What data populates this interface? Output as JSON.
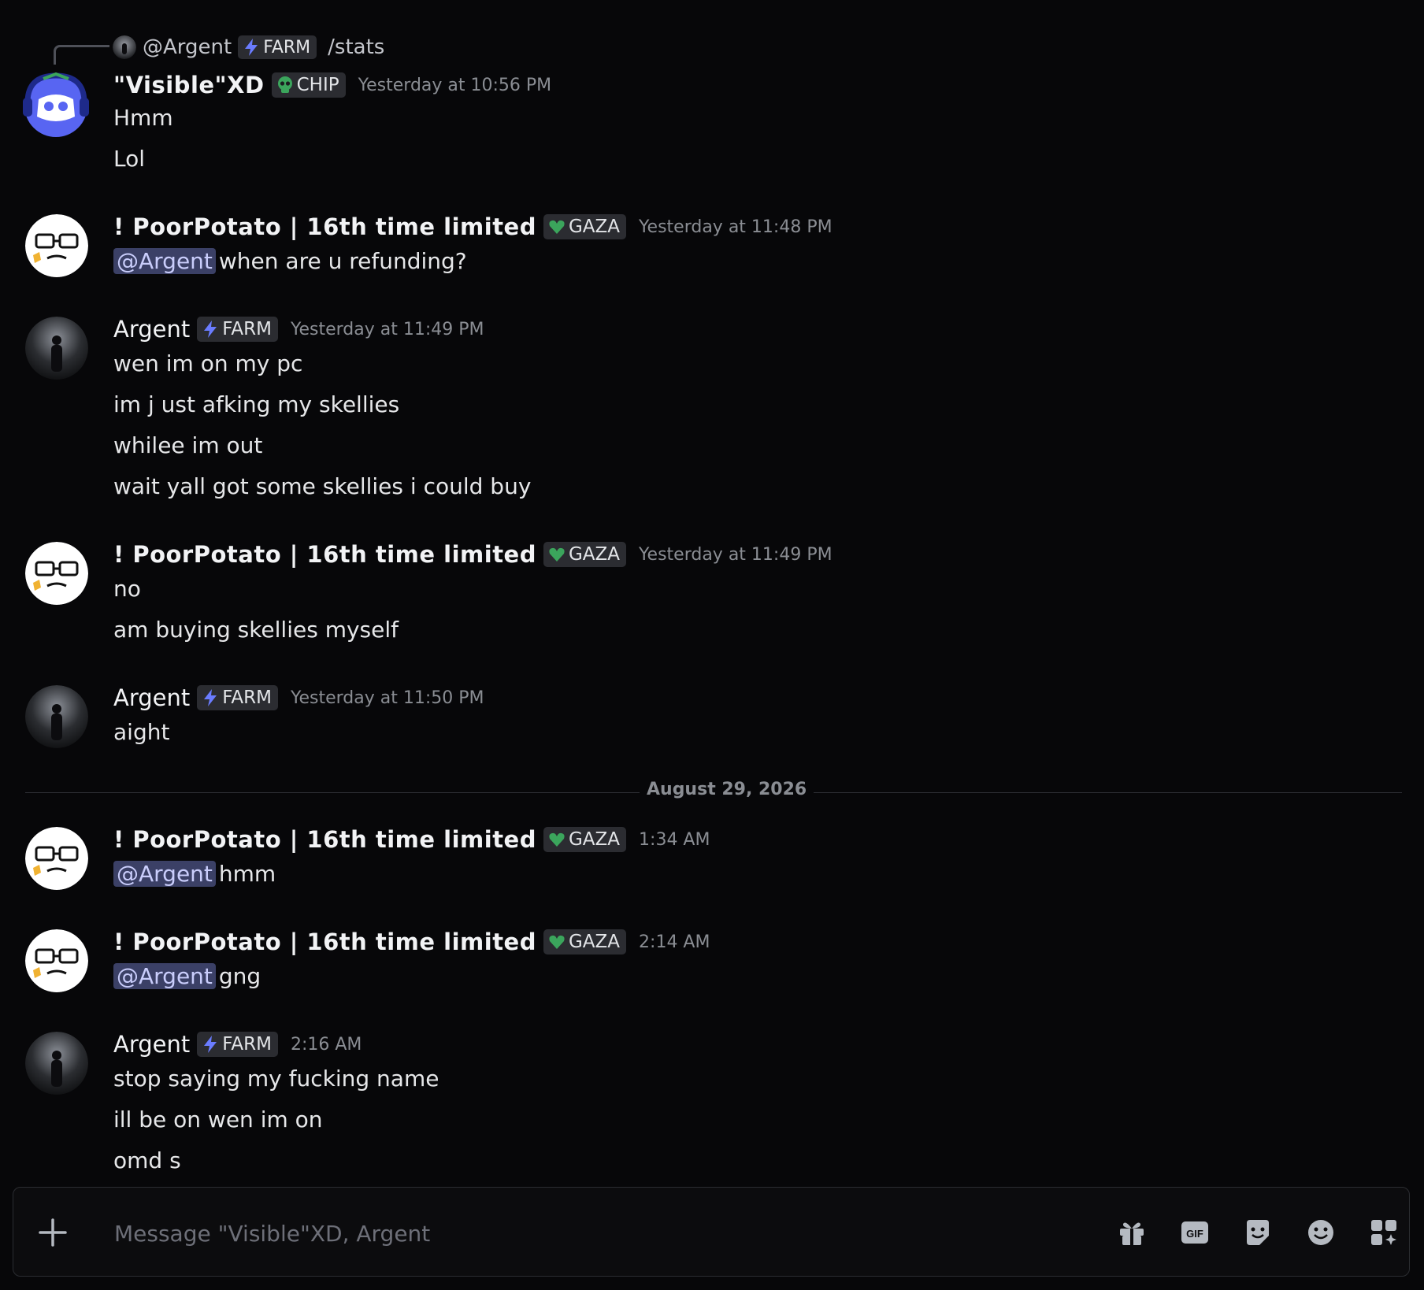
{
  "reply": {
    "mention": "@Argent",
    "tag": "FARM",
    "command": "/stats"
  },
  "messages": [
    {
      "author": "\"Visible\"XD",
      "tag": "CHIP",
      "time": "Yesterday at 10:56 PM",
      "lines": [
        "Hmm",
        "Lol"
      ]
    },
    {
      "author": "! PoorPotato | 16th time limited",
      "tag": "GAZA",
      "time": "Yesterday at 11:48 PM",
      "mention": "@Argent",
      "lines": [
        "when are u refunding?"
      ]
    },
    {
      "author": "Argent",
      "tag": "FARM",
      "time": "Yesterday at 11:49 PM",
      "lines": [
        "wen im on my pc",
        "im j ust afking my skellies",
        "whilee im out",
        "wait yall got some skellies i could buy"
      ]
    },
    {
      "author": "! PoorPotato | 16th time limited",
      "tag": "GAZA",
      "time": "Yesterday at 11:49 PM",
      "lines": [
        "no",
        "am buying skellies myself"
      ]
    },
    {
      "author": "Argent",
      "tag": "FARM",
      "time": "Yesterday at 11:50 PM",
      "lines": [
        "aight"
      ]
    },
    {
      "author": "! PoorPotato | 16th time limited",
      "tag": "GAZA",
      "time": "1:34 AM",
      "mention": "@Argent",
      "lines": [
        "hmm"
      ]
    },
    {
      "author": "! PoorPotato | 16th time limited",
      "tag": "GAZA",
      "time": "2:14 AM",
      "mention": "@Argent",
      "lines": [
        "gng"
      ]
    },
    {
      "author": "Argent",
      "tag": "FARM",
      "time": "2:16 AM",
      "lines": [
        "stop saying my fucking name",
        "ill  be on wen im on",
        "omd s"
      ]
    }
  ],
  "date_divider": "August 29, 2026",
  "composer": {
    "placeholder": "Message \"Visible\"XD, Argent",
    "gif_label": "GIF"
  },
  "colors": {
    "background": "#070709",
    "mention_bg": "#3b4066",
    "blurple": "#5865f2",
    "farm_bolt": "#6a7cff",
    "gaza_heart": "#3ba55c"
  }
}
